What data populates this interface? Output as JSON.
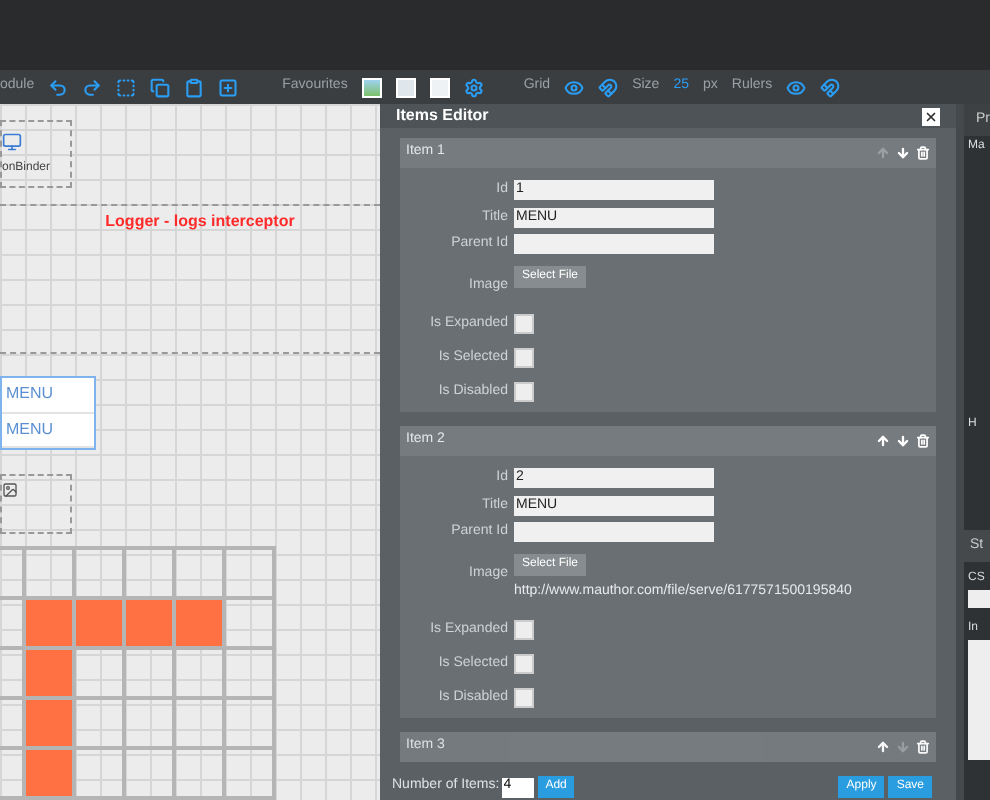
{
  "toolbar": {
    "module_label": "odule",
    "favourites_label": "Favourites",
    "grid_label": "Grid",
    "size_label": "Size",
    "size_value": "25",
    "size_unit": "px",
    "rulers_label": "Rulers"
  },
  "canvas": {
    "binder_label": "onBinder",
    "logger_title": "Logger - logs interceptor",
    "menu_items": [
      "MENU",
      "MENU"
    ],
    "grid_rows": [
      [
        false,
        false,
        false,
        false,
        false,
        false
      ],
      [
        false,
        true,
        true,
        true,
        true,
        false
      ],
      [
        false,
        true,
        false,
        false,
        false,
        false
      ],
      [
        false,
        true,
        false,
        false,
        false,
        false
      ],
      [
        false,
        true,
        false,
        false,
        false,
        false
      ]
    ]
  },
  "dialog": {
    "title": "Items Editor",
    "items": [
      {
        "title": "Item 1",
        "expanded": true,
        "can_move_up": false,
        "can_move_down": true,
        "fields": [
          {
            "label": "Id",
            "value": "1"
          },
          {
            "label": "Title",
            "value": "MENU"
          },
          {
            "label": "Parent Id"
          }
        ],
        "image_label": "Image",
        "image_button": "Select File",
        "checks": [
          {
            "label": "Is Expanded",
            "checked": false
          },
          {
            "label": "Is Selected",
            "checked": false
          },
          {
            "label": "Is Disabled",
            "checked": false
          }
        ]
      },
      {
        "title": "Item 2",
        "expanded": true,
        "can_move_up": true,
        "can_move_down": true,
        "fields": [
          {
            "label": "Id",
            "value": "2"
          },
          {
            "label": "Title",
            "value": "MENU"
          },
          {
            "label": "Parent Id"
          }
        ],
        "image_label": "Image",
        "image_button": "Select File",
        "image_url": "http://www.mauthor.com/file/serve/6177571500195840",
        "checks": [
          {
            "label": "Is Expanded",
            "checked": false
          },
          {
            "label": "Is Selected",
            "checked": false
          },
          {
            "label": "Is Disabled",
            "checked": false
          }
        ]
      },
      {
        "title": "Item 3",
        "expanded": false,
        "can_move_up": true,
        "can_move_down": false
      }
    ],
    "count_label": "Number of Items:",
    "count_value": "4",
    "add_button": "Add",
    "apply_button": "Apply",
    "save_button": "Save"
  },
  "right_panel": {
    "tab": "Pr",
    "section_1": "Ma",
    "row_label": "H",
    "section_2": "St",
    "field_1_label": "CS",
    "field_2_label": "In"
  }
}
